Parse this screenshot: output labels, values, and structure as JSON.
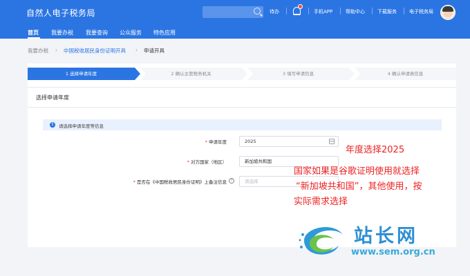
{
  "header": {
    "title": "自然人电子税务局",
    "search_placeholder": "",
    "todo": "待办",
    "app": "手机APP",
    "help": "帮助中心",
    "download": "下载服务",
    "etax": "电子税务局"
  },
  "nav": {
    "items": [
      "首页",
      "我要办税",
      "我要查询",
      "公众服务",
      "特色应用"
    ]
  },
  "breadcrumb": {
    "items": [
      "我要办税",
      "中国税收居民身份证明开具",
      "申请开具"
    ]
  },
  "steps": [
    {
      "label": "1  选择申请年度",
      "active": true
    },
    {
      "label": "2  确认主管税务机关",
      "active": false
    },
    {
      "label": "3  填写申请信息",
      "active": false
    },
    {
      "label": "4  确认申请表信息",
      "active": false
    }
  ],
  "section": {
    "title": "选择申请年度",
    "info": "请选择申请年度等信息"
  },
  "form": {
    "year": {
      "label": "申请年度",
      "value": "2025"
    },
    "country": {
      "label": "对方国家（地区）",
      "value": "新加坡共和国"
    },
    "remark": {
      "label": "是否在《中国税收居民身份证明》上备注信息",
      "placeholder": "请选择"
    }
  },
  "annotations": {
    "line1": "年度选择2025",
    "line2": "国家如果是谷歌证明使用就选择",
    "line3": "“新加坡共和国”，其他使用，按",
    "line4": "实际需求选择"
  },
  "watermark": {
    "text": "站长网",
    "url": "www.sem.org.cn"
  },
  "colors": {
    "brand": "#2b75e3",
    "annotation": "#ee2222"
  }
}
